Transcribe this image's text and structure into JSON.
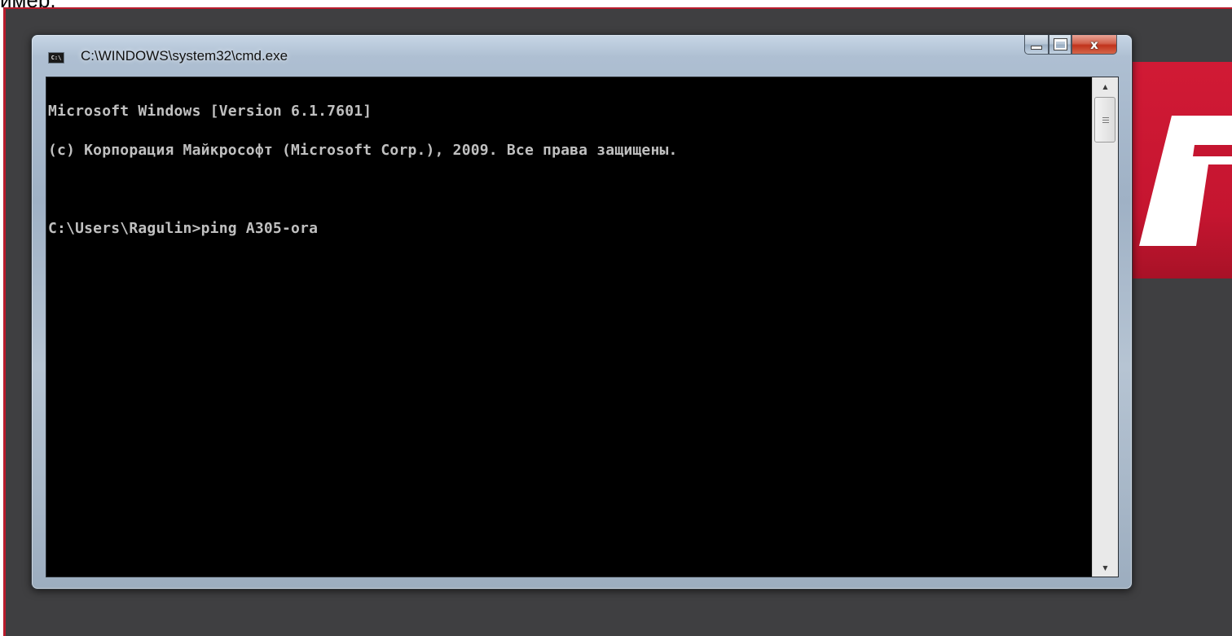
{
  "slide_caption": "имер.",
  "window": {
    "title": "C:\\WINDOWS\\system32\\cmd.exe",
    "icon": "cmd-icon",
    "icon_text": "C:\\",
    "buttons": {
      "minimize": "minimize-icon",
      "maximize": "maximize-icon",
      "close": "close-icon",
      "close_glyph": "x"
    }
  },
  "console": {
    "lines": [
      "Microsoft Windows [Version 6.1.7601]",
      "(c) Корпорация Майкрософт (Microsoft Corp.), 2009. Все права защищены.",
      "",
      "C:\\Users\\Ragulin>ping A305-ora"
    ],
    "text_color": "#c0c0c0",
    "background": "#000000"
  },
  "scrollbar": {
    "up_arrow": "▲",
    "down_arrow": "▼"
  },
  "colors": {
    "slide_border": "#b81b2c",
    "slide_background": "#3f3f41",
    "brand_red": "#c8102e"
  }
}
